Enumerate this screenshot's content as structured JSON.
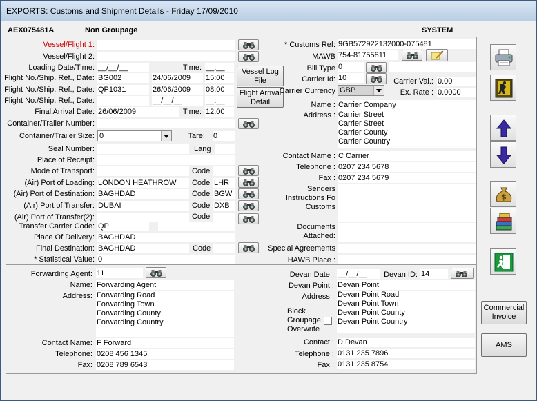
{
  "window": {
    "title": "EXPORTS: Customs and Shipment Details - Friday 17/09/2010"
  },
  "header": {
    "ref": "AEX075481A",
    "groupage": "Non Groupage",
    "user": "SYSTEM"
  },
  "left": {
    "vessel1_label": "Vessel/Flight 1:",
    "vessel2_label": "Vessel/Flight 2:",
    "loading_label": "Loading Date/Time:",
    "loading_date": "__/__/__",
    "time_label": "Time:",
    "loading_time": "__:__",
    "flight_label": "Flight No./Ship. Ref., Date:",
    "flight1_no": "BG002",
    "flight1_date": "24/06/2009",
    "flight1_time": "15:00",
    "flight2_no": "QP1031",
    "flight2_date": "26/06/2009",
    "flight2_time": "08:00",
    "flight3_date": "__/__/__",
    "flight3_time": "__:__",
    "vessel_log_btn1": "Vessel Log",
    "vessel_log_btn2": "File",
    "flight_arrival_btn1": "Flight Arrival",
    "flight_arrival_btn2": "Detail",
    "final_arrival_label": "Final Arrival Date:",
    "final_arrival_date": "26/06/2009",
    "final_arrival_time": "12:00",
    "container_no_label": "Container/Trailer Number:",
    "container_size_label": "Container/Trailer Size:",
    "container_size_value": "0",
    "tare_label": "Tare:",
    "tare_value": "0",
    "seal_label": "Seal Number:",
    "lang_label": "Lang",
    "receipt_label": "Place of Receipt:",
    "transport_label": "Mode of Transport:",
    "code_label": "Code",
    "pol_label": "(Air) Port of Loading:",
    "pol_value": "LONDON HEATHROW",
    "pol_code": "LHR",
    "pod_label": "(Air) Port of Destination:",
    "pod_value": "BAGHDAD",
    "pod_code": "BGW",
    "pot_label": "(Air) Port of Transfer:",
    "pot_value": "DUBAI",
    "pot_code": "DXB",
    "pot2_label": "(Air) Port of Transfer(2):",
    "transfer_carrier_label": "Transfer Carrier Code:",
    "transfer_carrier_value": "QP",
    "delivery_label": "Place Of Delivery:",
    "delivery_value": "BAGHDAD",
    "final_dest_label": "Final Destination:",
    "final_dest_value": "BAGHDAD",
    "stat_label": "* Statistical Value:",
    "stat_value": "0"
  },
  "right": {
    "customs_ref_label": "* Customs Ref:",
    "customs_ref_value": "9GB572922132000-075481",
    "mawb_label": "MAWB",
    "mawb_value": "754-81755811",
    "bill_type_label": "Bill Type",
    "bill_type_value": "0",
    "carrier_id_label": "Carrier Id:",
    "carrier_id_value": "10",
    "carrier_val_label": "Carrier Val.:",
    "carrier_val_value": "0.00",
    "carrier_currency_label": "Carrier Currency",
    "carrier_currency_value": "GBP",
    "ex_rate_label": "Ex. Rate :",
    "ex_rate_value": "0.0000",
    "name_label": "Name :",
    "name_value": "Carrier Company",
    "address_label": "Address :",
    "address_lines": [
      "Carrier Street",
      "Carrier Street",
      "Carrier County",
      "Carrier Country"
    ],
    "contact_label": "Contact Name :",
    "contact_value": "C Carrier",
    "telephone_label": "Telephone :",
    "telephone_value": "0207 234 5678",
    "fax_label": "Fax :",
    "fax_value": "0207 234 5679",
    "sender_label_lines": [
      "Senders",
      "Instructions Fo",
      "Customs"
    ],
    "documents_label_lines": [
      "Documents",
      "Attached:"
    ],
    "special_label": "Special Agreements",
    "hawb_label": "HAWB Place :"
  },
  "forwarding": {
    "agent_label": "Forwarding Agent:",
    "agent_value": "11",
    "name_label": "Name:",
    "name_value": "Forwarding Agent",
    "address_label": "Address:",
    "address_lines": [
      "Forwarding Road",
      "Forwarding Town",
      "Forwarding County",
      "Forwarding Country"
    ],
    "contact_label": "Contact Name:",
    "contact_value": "F Forward",
    "telephone_label": "Telephone:",
    "telephone_value": "0208 456 1345",
    "fax_label": "Fax:",
    "fax_value": "0208 789 6543"
  },
  "devan": {
    "date_label": "Devan Date :",
    "date_value": "__/__/__",
    "id_label": "Devan ID:",
    "id_value": "14",
    "point_label": "Devan Point :",
    "point_value": "Devan Point",
    "address_label": "Address :",
    "address_lines": [
      "Devan Point Road",
      "Devan Point Town",
      "Devan Point County",
      "Devan Point Country"
    ],
    "block_label_lines": [
      "Block",
      "Groupage",
      "Overwrite"
    ],
    "contact_label": "Contact :",
    "contact_value": "D Devan",
    "telephone_label": "Telephone :",
    "telephone_value": "0131 235 7896",
    "fax_label": "Fax :",
    "fax_value": "0131 235 8754"
  },
  "side": {
    "commercial_invoice_1": "Commercial",
    "commercial_invoice_2": "Invoice",
    "ams": "AMS",
    "icons": [
      "printer-icon",
      "exit-door-icon",
      "arrow-up-icon",
      "arrow-down-icon",
      "money-bag-icon",
      "books-icon",
      "emergency-exit-icon"
    ]
  }
}
